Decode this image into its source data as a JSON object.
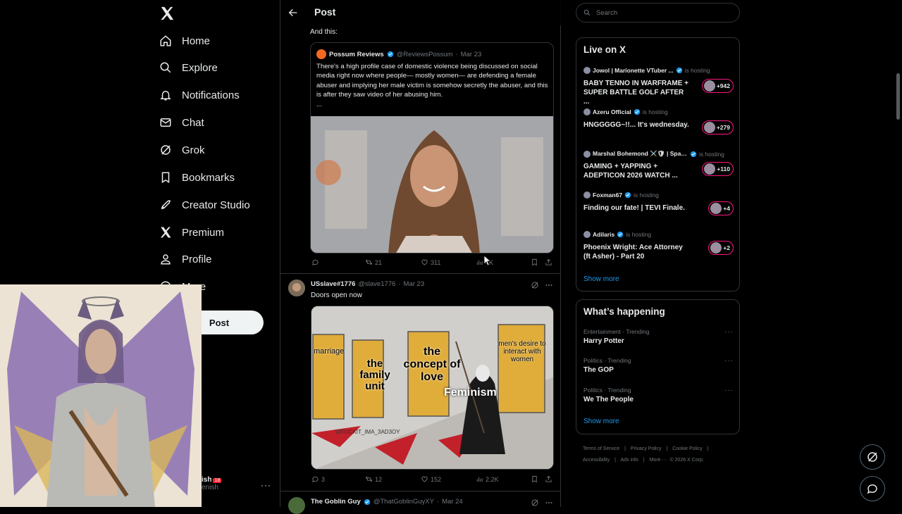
{
  "nav": {
    "items": [
      {
        "label": "Home",
        "icon": "home-icon"
      },
      {
        "label": "Explore",
        "icon": "search-icon"
      },
      {
        "label": "Notifications",
        "icon": "bell-icon"
      },
      {
        "label": "Chat",
        "icon": "mail-icon"
      },
      {
        "label": "Grok",
        "icon": "grok-icon"
      },
      {
        "label": "Bookmarks",
        "icon": "bookmark-icon"
      },
      {
        "label": "Creator Studio",
        "icon": "rocket-icon"
      },
      {
        "label": "Premium",
        "icon": "x-logo-icon"
      },
      {
        "label": "Profile",
        "icon": "person-icon"
      },
      {
        "label": "More",
        "icon": "more-circle-icon"
      }
    ],
    "post_button": "Post",
    "user": {
      "name_fragment": "ish",
      "badge": "18",
      "handle_fragment": "enish"
    },
    "user_more": "···"
  },
  "header": {
    "title": "Post"
  },
  "thread": {
    "intro_text": "And this:",
    "quote": {
      "name": "Possum Reviews",
      "handle": "@ReviewsPossum",
      "date": "Mar 23",
      "text": "There's a high profile case of domestic violence being discussed on social media right now where people— mostly women— are defending a female abuser and implying her male victim is somehow secretly the abuser, and this is after they saw video of her abusing him.",
      "ellipsis": "..."
    },
    "actions1": {
      "replies": "",
      "reposts": "21",
      "likes": "311",
      "views": "4K"
    }
  },
  "post2": {
    "name": "USslave#1776",
    "handle": "@slave1776",
    "date": "Mar 23",
    "text": "Doors open now",
    "meme_labels": [
      "marriage",
      "the family unit",
      "the concept of love",
      "men's desire to interact with women",
      "Feminism",
      "U/FUCKIT_IMA_3AD3OY"
    ],
    "actions": {
      "replies": "3",
      "reposts": "12",
      "likes": "152",
      "views": "2.2K"
    }
  },
  "post3": {
    "name": "The Goblin Guy",
    "handle": "@ThatGoblinGuyXY",
    "date": "Mar 24"
  },
  "search": {
    "placeholder": "Search"
  },
  "live": {
    "title": "Live on X",
    "items": [
      {
        "host": "Jowol | Marionette VTuber ...",
        "status": "is hosting",
        "title": "BABY TENNO IN WARFRAME + SUPER BATTLE GOLF AFTER ...",
        "count": "+942"
      },
      {
        "host": "Azeru Official",
        "status": "is hosting",
        "title": "HNGGGGG~!!... It's wednesday.",
        "count": "+279"
      },
      {
        "host": "Marshal Bohemond ⚔️🛡 | Spac...",
        "status": "is hosting",
        "title": "GAMING + YAPPING + ADEPTICON 2026 WATCH ...",
        "count": "+110"
      },
      {
        "host": "Foxman67",
        "status": "is hosting",
        "title": "Finding our fate! | TEVI Finale.",
        "count": "+4"
      },
      {
        "host": "Adilaris",
        "status": "is hosting",
        "title": "Phoenix Wright: Ace Attorney (ft Asher) - Part 20",
        "count": "+2"
      }
    ],
    "show_more": "Show more"
  },
  "happening": {
    "title": "What’s happening",
    "trends": [
      {
        "context": "Entertainment · Trending",
        "topic": "Harry Potter"
      },
      {
        "context": "Politics · Trending",
        "topic": "The GOP"
      },
      {
        "context": "Politics · Trending",
        "topic": "We The People"
      }
    ],
    "show_more": "Show more"
  },
  "footer": {
    "links": [
      "Terms of Service",
      "Privacy Policy",
      "Cookie Policy",
      "Accessibility",
      "Ads info",
      "More ···"
    ],
    "copyright": "© 2026 X Corp."
  },
  "colors": {
    "accent": "#1d9bf0",
    "live_ring": "#f91880",
    "border": "#2f3336",
    "muted": "#71767b"
  }
}
